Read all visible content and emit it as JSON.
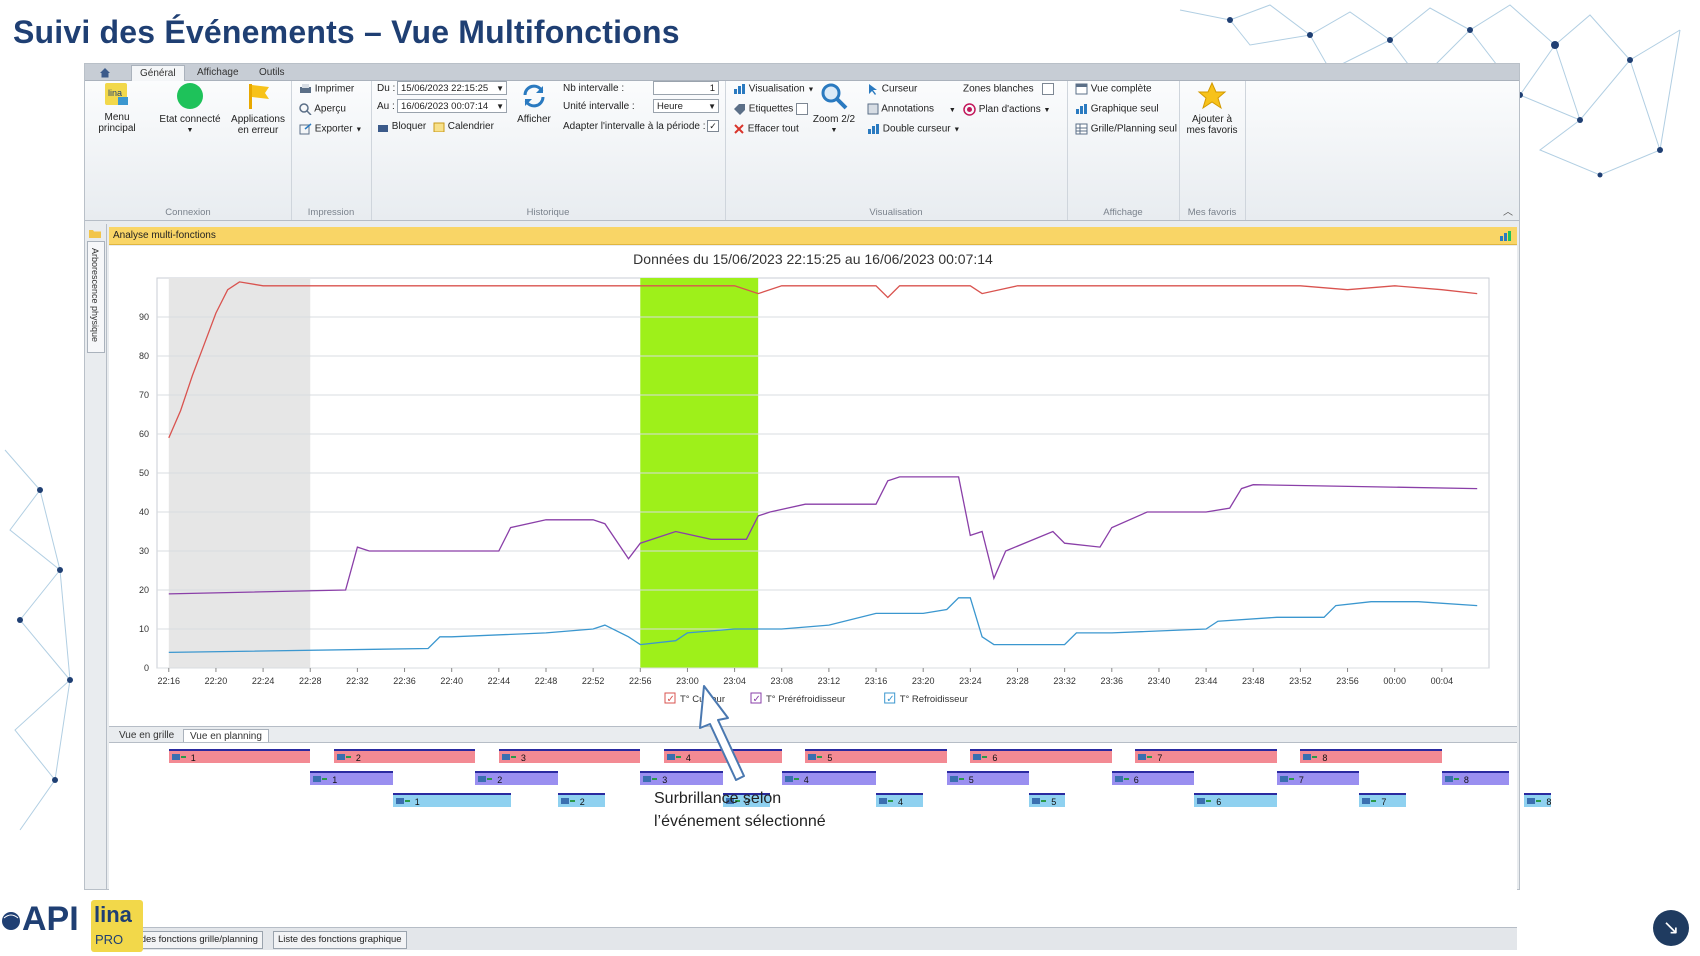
{
  "slide": {
    "title": "Suivi des Événements – Vue Multifonctions"
  },
  "tabs": [
    {
      "label": "Général"
    },
    {
      "label": "Affichage"
    },
    {
      "label": "Outils"
    }
  ],
  "ribbon": {
    "connexion": {
      "menu_principal": "Menu principal",
      "etat_connecte": "Etat connecté",
      "applications_l1": "Applications",
      "applications_l2": "en erreur",
      "group_label": "Connexion"
    },
    "impression": {
      "imprimer": "Imprimer",
      "apercu": "Aperçu",
      "exporter": "Exporter",
      "group_label": "Impression"
    },
    "historique": {
      "du_label": "Du :",
      "du_value": "15/06/2023 22:15:25",
      "au_label": "Au :",
      "au_value": "16/06/2023 00:07:14",
      "bloquer": "Bloquer",
      "calendrier": "Calendrier",
      "afficher": "Afficher",
      "nb_intervalle_label": "Nb intervalle :",
      "nb_intervalle_value": "1",
      "unite_label": "Unité intervalle :",
      "unite_value": "Heure",
      "adapter_label": "Adapter l'intervalle à la période :",
      "group_label": "Historique"
    },
    "visualisation": {
      "visualisation": "Visualisation",
      "etiquettes": "Etiquettes",
      "effacer_tout": "Effacer tout",
      "zoom": "Zoom 2/2",
      "curseur": "Curseur",
      "annotations": "Annotations",
      "double_curseur": "Double curseur",
      "zones_blanches": "Zones blanches",
      "plan_actions": "Plan d'actions",
      "group_label": "Visualisation"
    },
    "affichage": {
      "vue_complete": "Vue complète",
      "graphique_seul": "Graphique seul",
      "grille_planning_seul": "Grille/Planning seul",
      "group_label": "Affichage"
    },
    "favoris": {
      "ajouter_l1": "Ajouter à",
      "ajouter_l2": "mes favoris",
      "group_label": "Mes favoris"
    }
  },
  "side_tab": "Arborescence physique",
  "panel_header": "Analyse multi-fonctions",
  "chart_data": {
    "type": "line",
    "title": "Données du 15/06/2023 22:15:25 au 16/06/2023 00:07:14",
    "xlabel": "",
    "ylabel": "",
    "ylim": [
      0,
      100
    ],
    "y_ticks": [
      "0",
      "10",
      "20",
      "30",
      "40",
      "50",
      "60",
      "70",
      "80",
      "90"
    ],
    "x_ticks": [
      "22:16",
      "22:20",
      "22:24",
      "22:28",
      "22:32",
      "22:36",
      "22:40",
      "22:44",
      "22:48",
      "22:52",
      "22:56",
      "23:00",
      "23:04",
      "23:08",
      "23:12",
      "23:16",
      "23:20",
      "23:24",
      "23:28",
      "23:32",
      "23:36",
      "23:40",
      "23:44",
      "23:48",
      "23:52",
      "23:56",
      "00:00",
      "00:04"
    ],
    "grey_zone": [
      "22:16",
      "22:28"
    ],
    "highlight_zone": [
      "22:56",
      "23:06"
    ],
    "grid": true,
    "legend_placement": "bottom-center",
    "series": [
      {
        "name": "T° Cuiseur",
        "color": "#d9534f",
        "points": [
          [
            "22:16",
            59
          ],
          [
            "22:17",
            66
          ],
          [
            "22:18",
            75
          ],
          [
            "22:19",
            83
          ],
          [
            "22:20",
            91
          ],
          [
            "22:21",
            97
          ],
          [
            "22:22",
            99
          ],
          [
            "22:24",
            98
          ],
          [
            "22:28",
            98
          ],
          [
            "22:36",
            98
          ],
          [
            "22:44",
            98
          ],
          [
            "22:52",
            98
          ],
          [
            "22:56",
            98
          ],
          [
            "23:04",
            98
          ],
          [
            "23:06",
            96
          ],
          [
            "23:08",
            98
          ],
          [
            "23:16",
            98
          ],
          [
            "23:17",
            95
          ],
          [
            "23:18",
            98
          ],
          [
            "23:24",
            98
          ],
          [
            "23:25",
            96
          ],
          [
            "23:28",
            98
          ],
          [
            "23:36",
            98
          ],
          [
            "23:44",
            98
          ],
          [
            "23:52",
            98
          ],
          [
            "23:56",
            97
          ],
          [
            "00:00",
            98
          ],
          [
            "00:04",
            97
          ],
          [
            "00:07",
            96
          ]
        ]
      },
      {
        "name": "T° Préréfroidisseur",
        "color": "#8a3fa8",
        "points": [
          [
            "22:16",
            19
          ],
          [
            "22:31",
            20
          ],
          [
            "22:32",
            31
          ],
          [
            "22:33",
            30
          ],
          [
            "22:44",
            30
          ],
          [
            "22:45",
            36
          ],
          [
            "22:48",
            38
          ],
          [
            "22:52",
            38
          ],
          [
            "22:53",
            37
          ],
          [
            "22:55",
            28
          ],
          [
            "22:56",
            32
          ],
          [
            "22:59",
            35
          ],
          [
            "23:02",
            33
          ],
          [
            "23:05",
            33
          ],
          [
            "23:06",
            39
          ],
          [
            "23:07",
            40
          ],
          [
            "23:10",
            42
          ],
          [
            "23:16",
            42
          ],
          [
            "23:17",
            48
          ],
          [
            "23:18",
            49
          ],
          [
            "23:23",
            49
          ],
          [
            "23:24",
            34
          ],
          [
            "23:25",
            35
          ],
          [
            "23:26",
            23
          ],
          [
            "23:27",
            30
          ],
          [
            "23:31",
            35
          ],
          [
            "23:32",
            32
          ],
          [
            "23:35",
            31
          ],
          [
            "23:36",
            36
          ],
          [
            "23:39",
            40
          ],
          [
            "23:42",
            40
          ],
          [
            "23:44",
            40
          ],
          [
            "23:46",
            41
          ],
          [
            "23:47",
            46
          ],
          [
            "23:48",
            47
          ],
          [
            "00:07",
            46
          ]
        ]
      },
      {
        "name": "T° Refroidisseur",
        "color": "#3b97cf",
        "points": [
          [
            "22:16",
            4
          ],
          [
            "22:38",
            5
          ],
          [
            "22:39",
            8
          ],
          [
            "22:40",
            8
          ],
          [
            "22:48",
            9
          ],
          [
            "22:52",
            10
          ],
          [
            "22:53",
            11
          ],
          [
            "22:55",
            8
          ],
          [
            "22:56",
            6
          ],
          [
            "22:59",
            7
          ],
          [
            "23:00",
            9
          ],
          [
            "23:04",
            10
          ],
          [
            "23:08",
            10
          ],
          [
            "23:12",
            11
          ],
          [
            "23:16",
            14
          ],
          [
            "23:20",
            14
          ],
          [
            "23:22",
            15
          ],
          [
            "23:23",
            18
          ],
          [
            "23:24",
            18
          ],
          [
            "23:25",
            8
          ],
          [
            "23:26",
            6
          ],
          [
            "23:32",
            6
          ],
          [
            "23:33",
            9
          ],
          [
            "23:36",
            9
          ],
          [
            "23:44",
            10
          ],
          [
            "23:45",
            12
          ],
          [
            "23:50",
            13
          ],
          [
            "23:54",
            13
          ],
          [
            "23:55",
            16
          ],
          [
            "23:58",
            17
          ],
          [
            "00:02",
            17
          ],
          [
            "00:07",
            16
          ]
        ]
      }
    ]
  },
  "bottom_tabs": [
    {
      "label": "Vue en grille"
    },
    {
      "label": "Vue en planning"
    }
  ],
  "planning": {
    "rows": [
      {
        "color": "r",
        "events": [
          {
            "label": "1",
            "start": "22:16",
            "end": "22:28"
          },
          {
            "label": "2",
            "start": "22:30",
            "end": "22:42"
          },
          {
            "label": "3",
            "start": "22:44",
            "end": "22:56"
          },
          {
            "label": "4",
            "start": "22:58",
            "end": "23:08"
          },
          {
            "label": "5",
            "start": "23:10",
            "end": "23:22"
          },
          {
            "label": "6",
            "start": "23:24",
            "end": "23:36"
          },
          {
            "label": "7",
            "start": "23:38",
            "end": "23:50"
          },
          {
            "label": "8",
            "start": "23:52",
            "end": "00:04"
          }
        ]
      },
      {
        "color": "p",
        "events": [
          {
            "label": "1",
            "start": "22:28",
            "end": "22:35"
          },
          {
            "label": "2",
            "start": "22:42",
            "end": "22:49"
          },
          {
            "label": "3",
            "start": "22:56",
            "end": "23:03"
          },
          {
            "label": "4",
            "start": "23:08",
            "end": "23:16"
          },
          {
            "label": "5",
            "start": "23:22",
            "end": "23:29"
          },
          {
            "label": "6",
            "start": "23:36",
            "end": "23:43"
          },
          {
            "label": "7",
            "start": "23:50",
            "end": "23:57"
          },
          {
            "label": "8",
            "start": "00:04",
            "end": "00:11"
          }
        ]
      },
      {
        "color": "b",
        "events": [
          {
            "label": "1",
            "start": "22:35",
            "end": "22:45"
          },
          {
            "label": "2",
            "start": "22:49",
            "end": "22:53"
          },
          {
            "label": "3",
            "start": "23:03",
            "end": "23:07"
          },
          {
            "label": "4",
            "start": "23:16",
            "end": "23:20"
          },
          {
            "label": "5",
            "start": "23:29",
            "end": "23:32"
          },
          {
            "label": "6",
            "start": "23:43",
            "end": "23:50"
          },
          {
            "label": "7",
            "start": "23:57",
            "end": "00:01"
          },
          {
            "label": "8",
            "start": "00:11",
            "end": "00:19"
          }
        ]
      }
    ]
  },
  "status_buttons": [
    {
      "label": "Liste des fonctions grille/planning"
    },
    {
      "label": "Liste des fonctions graphique"
    }
  ],
  "callout": {
    "line1": "Surbrillance selon",
    "line2": "l’événement sélectionné"
  },
  "logos": {
    "api": "API",
    "lina": "lina",
    "pro": "PRO"
  }
}
